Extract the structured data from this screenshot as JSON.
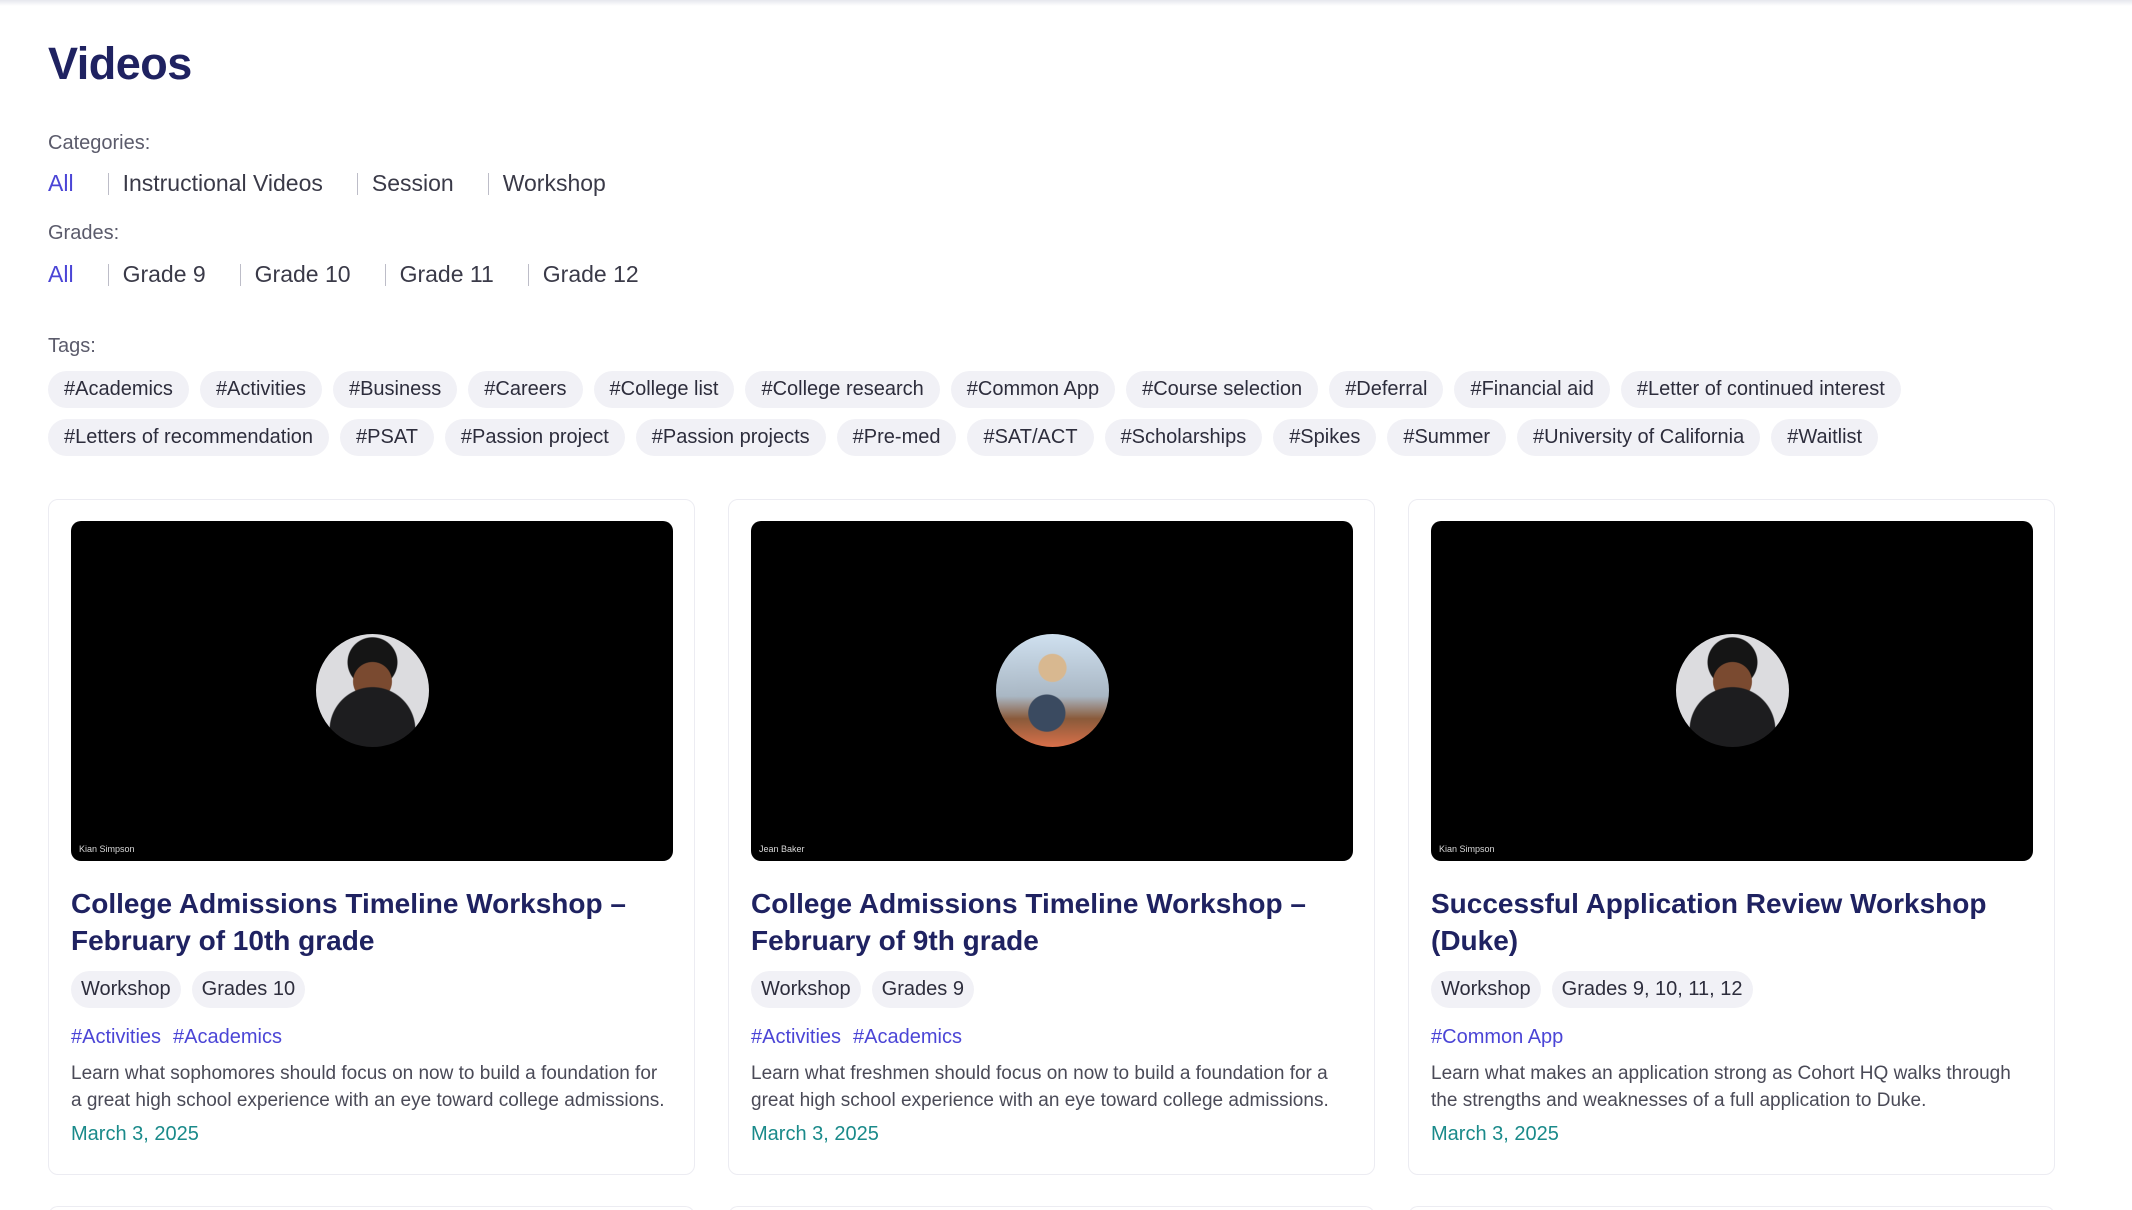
{
  "page": {
    "title": "Videos"
  },
  "filters": {
    "categories_label": "Categories:",
    "categories": [
      "All",
      "Instructional Videos",
      "Session",
      "Workshop"
    ],
    "grades_label": "Grades:",
    "grades": [
      "All",
      "Grade 9",
      "Grade 10",
      "Grade 11",
      "Grade 12"
    ],
    "tags_label": "Tags:",
    "tags": [
      "#Academics",
      "#Activities",
      "#Business",
      "#Careers",
      "#College list",
      "#College research",
      "#Common App",
      "#Course selection",
      "#Deferral",
      "#Financial aid",
      "#Letter of continued interest",
      "#Letters of recommendation",
      "#PSAT",
      "#Passion project",
      "#Passion projects",
      "#Pre-med",
      "#SAT/ACT",
      "#Scholarships",
      "#Spikes",
      "#Summer",
      "#University of California",
      "#Waitlist"
    ]
  },
  "colors": {
    "accent": "#4b45d6",
    "title": "#1f2261",
    "date": "#1a8a8a"
  },
  "cards": [
    {
      "speaker": "Kian Simpson",
      "title": "College Admissions Timeline Workshop – February of 10th grade",
      "category": "Workshop",
      "grades": "Grades 10",
      "tags": [
        "#Activities",
        "#Academics"
      ],
      "description": "Learn what sophomores should focus on now to build a foundation for a great high school experience with an eye toward college admissions.",
      "date": "March 3, 2025"
    },
    {
      "speaker": "Jean Baker",
      "title": "College Admissions Timeline Workshop – February of 9th grade",
      "category": "Workshop",
      "grades": "Grades 9",
      "tags": [
        "#Activities",
        "#Academics"
      ],
      "description": "Learn what freshmen should focus on now to build a foundation for a great high school experience with an eye toward college admissions.",
      "date": "March 3, 2025"
    },
    {
      "speaker": "Kian Simpson",
      "title": "Successful Application Review Workshop (Duke)",
      "category": "Workshop",
      "grades": "Grades 9, 10, 11, 12",
      "tags": [
        "#Common App"
      ],
      "description": "Learn what makes an application strong as Cohort HQ walks through the strengths and weaknesses of a full application to Duke.",
      "date": "March 3, 2025"
    }
  ]
}
